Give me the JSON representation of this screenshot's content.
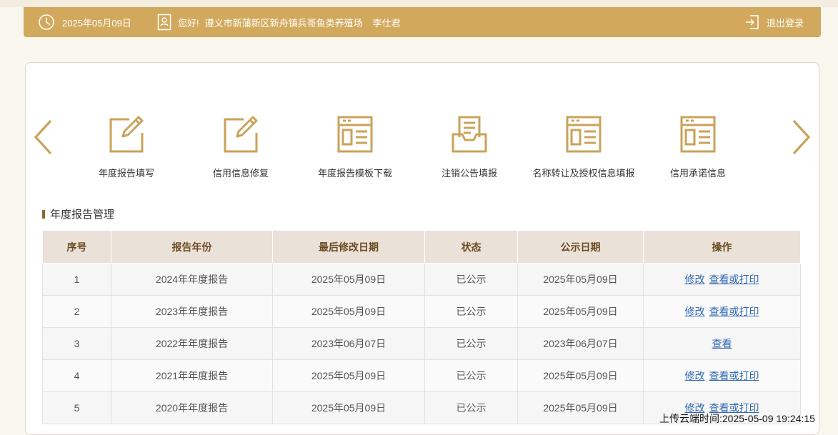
{
  "header": {
    "date": "2025年05月09日",
    "greeting": "您好!",
    "company": "遵义市新蒲新区新舟镇兵哥鱼类养殖场",
    "user": "李仕君",
    "logout_label": "退出登录"
  },
  "nav": {
    "items": [
      {
        "label": "年度报告填写",
        "icon": "edit-icon"
      },
      {
        "label": "信用信息修复",
        "icon": "edit-icon"
      },
      {
        "label": "年度报告模板下载",
        "icon": "template-icon"
      },
      {
        "label": "注销公告填报",
        "icon": "inbox-doc-icon"
      },
      {
        "label": "名称转让及授权信息填报",
        "icon": "template-icon"
      },
      {
        "label": "信用承诺信息",
        "icon": "template-icon"
      }
    ]
  },
  "section": {
    "title": "年度报告管理"
  },
  "table": {
    "headers": [
      "序号",
      "报告年份",
      "最后修改日期",
      "状态",
      "公示日期",
      "操作"
    ],
    "rows": [
      {
        "no": "1",
        "year": "2024年年度报告",
        "modified": "2025年05月09日",
        "status": "已公示",
        "published": "2025年05月09日",
        "ops": [
          "修改",
          "查看或打印"
        ]
      },
      {
        "no": "2",
        "year": "2023年年度报告",
        "modified": "2025年05月09日",
        "status": "已公示",
        "published": "2025年05月09日",
        "ops": [
          "修改",
          "查看或打印"
        ]
      },
      {
        "no": "3",
        "year": "2022年年度报告",
        "modified": "2023年06月07日",
        "status": "已公示",
        "published": "2023年06月07日",
        "ops": [
          "查看"
        ]
      },
      {
        "no": "4",
        "year": "2021年年度报告",
        "modified": "2025年05月09日",
        "status": "已公示",
        "published": "2025年05月09日",
        "ops": [
          "修改",
          "查看或打印"
        ]
      },
      {
        "no": "5",
        "year": "2020年年度报告",
        "modified": "2025年05月09日",
        "status": "已公示",
        "published": "2025年05月09日",
        "ops": [
          "修改",
          "查看或打印"
        ]
      }
    ]
  },
  "footer": {
    "upload_time": "上传云端时间:2025-05-09 19:24:15"
  },
  "colors": {
    "accent": "#d2a95c",
    "icon": "#c9a35a",
    "table_header_bg": "#eae2d8",
    "table_header_text": "#6b4a22",
    "link": "#2e67b2"
  }
}
